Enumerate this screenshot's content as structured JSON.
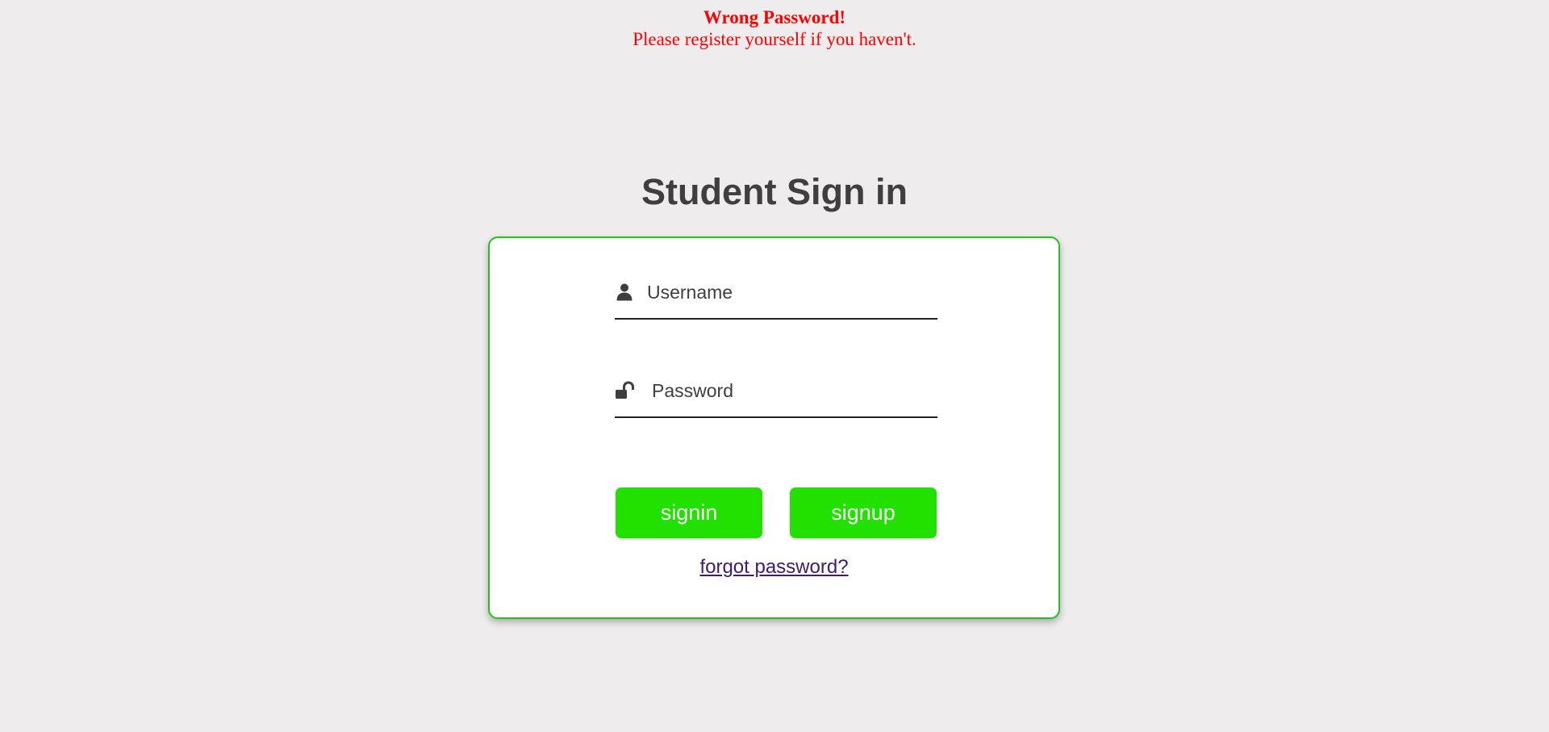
{
  "error": {
    "title": "Wrong Password!",
    "message": "Please register yourself if you haven't.",
    "color": "#ff0000"
  },
  "page": {
    "title": "Student Sign in"
  },
  "form": {
    "border_color": "#22c41a",
    "username": {
      "placeholder": "Username",
      "value": "",
      "icon": "user-icon"
    },
    "password": {
      "placeholder": "Password",
      "value": "",
      "icon": "unlock-icon"
    },
    "signin_label": "signin",
    "signup_label": "signup",
    "button_color": "#22e000",
    "forgot_label": "forgot password?",
    "link_color": "#3f1a6e"
  }
}
